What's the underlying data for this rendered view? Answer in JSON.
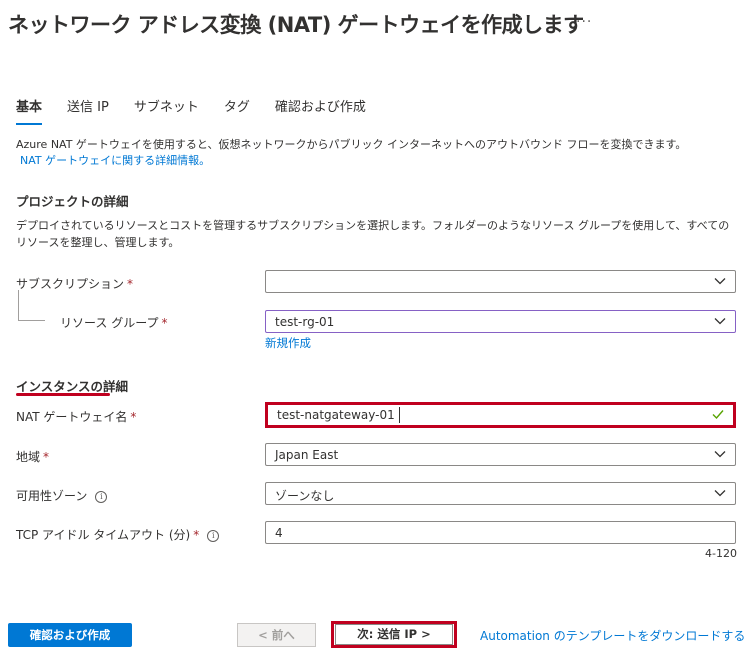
{
  "page": {
    "title": "ネットワーク アドレス変換 (NAT) ゲートウェイを作成します",
    "more_label": "···"
  },
  "tabs": [
    {
      "label": "基本",
      "active": true
    },
    {
      "label": "送信 IP",
      "active": false
    },
    {
      "label": "サブネット",
      "active": false
    },
    {
      "label": "タグ",
      "active": false
    },
    {
      "label": "確認および作成",
      "active": false
    }
  ],
  "intro": {
    "text": "Azure NAT ゲートウェイを使用すると、仮想ネットワークからパブリック インターネットへのアウトバウンド フローを変換できます。",
    "link": "NAT ゲートウェイに関する詳細情報。"
  },
  "project": {
    "heading": "プロジェクトの詳細",
    "description": "デプロイされているリソースとコストを管理するサブスクリプションを選択します。フォルダーのようなリソース グループを使用して、すべてのリソースを整理し、管理します。",
    "subscription_label": "サブスクリプション",
    "subscription_value": "",
    "resource_group_label": "リソース グループ",
    "resource_group_value": "test-rg-01",
    "create_new_link": "新規作成"
  },
  "instance": {
    "heading": "インスタンスの詳細",
    "name_label": "NAT ゲートウェイ名",
    "name_value": "test-natgateway-01",
    "region_label": "地域",
    "region_value": "Japan East",
    "zone_label": "可用性ゾーン",
    "zone_value": "ゾーンなし",
    "timeout_label": "TCP アイドル タイムアウト (分)",
    "timeout_value": "4",
    "timeout_range": "4-120"
  },
  "required_mark": "*",
  "info_glyph": "i",
  "footer": {
    "review_create": "確認および作成",
    "previous": "< 前へ",
    "next": "次: 送信 IP >",
    "download_template": "Automation のテンプレートをダウンロードする"
  },
  "colors": {
    "accent": "#0078d4",
    "highlight_red": "#c0001f",
    "required": "#a4262c",
    "valid_check": "#57a300",
    "focus_purple": "#8661c5"
  }
}
